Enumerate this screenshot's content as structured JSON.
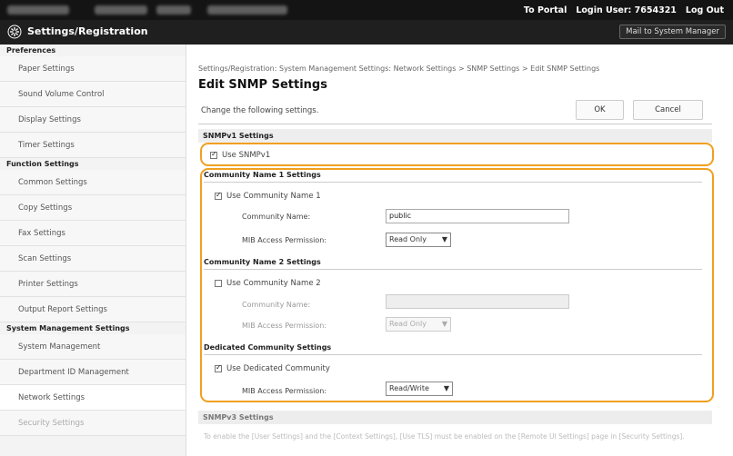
{
  "topbar": {
    "portal_label": "To Portal",
    "login_user_label": "Login User: 7654321",
    "logout_label": "Log Out"
  },
  "titlebar": {
    "title": "Settings/Registration",
    "mail_label": "Mail to System Manager"
  },
  "sidebar": {
    "sections": [
      {
        "header": "Preferences",
        "items": [
          "Paper Settings",
          "Sound Volume Control",
          "Display Settings",
          "Timer Settings"
        ]
      },
      {
        "header": "Function Settings",
        "items": [
          "Common Settings",
          "Copy Settings",
          "Fax Settings",
          "Scan Settings",
          "Printer Settings",
          "Output Report Settings"
        ]
      },
      {
        "header": "System Management Settings",
        "items": [
          "System Management",
          "Department ID Management",
          "Network Settings",
          "Security Settings"
        ]
      }
    ],
    "selected_item": "Network Settings"
  },
  "main": {
    "breadcrumb": "Settings/Registration: System Management Settings: Network Settings > SNMP Settings > Edit SNMP Settings",
    "title": "Edit SNMP Settings",
    "instructions": "Change the following settings.",
    "ok_label": "OK",
    "cancel_label": "Cancel",
    "snmpv1": {
      "header": "SNMPv1 Settings",
      "use_label": "Use SNMPv1",
      "use_checked": true
    },
    "community1": {
      "header": "Community Name 1 Settings",
      "use_label": "Use Community Name 1",
      "use_checked": true,
      "name_label": "Community Name:",
      "name_value": "public",
      "perm_label": "MIB Access Permission:",
      "perm_value": "Read Only"
    },
    "community2": {
      "header": "Community Name 2 Settings",
      "use_label": "Use Community Name 2",
      "use_checked": false,
      "name_label": "Community Name:",
      "name_value": "",
      "perm_label": "MIB Access Permission:",
      "perm_value": "Read Only"
    },
    "dedicated": {
      "header": "Dedicated Community Settings",
      "use_label": "Use Dedicated Community",
      "use_checked": true,
      "perm_label": "MIB Access Permission:",
      "perm_value": "Read/Write"
    },
    "snmpv3": {
      "header": "SNMPv3 Settings",
      "note": "To enable the [User Settings] and the [Context Settings], [Use TLS] must be enabled on the [Remote UI Settings] page in [Security Settings]."
    }
  },
  "colors": {
    "highlight": "#f0a020",
    "topbar": "#141414",
    "titlebar": "#1f1f1f"
  }
}
